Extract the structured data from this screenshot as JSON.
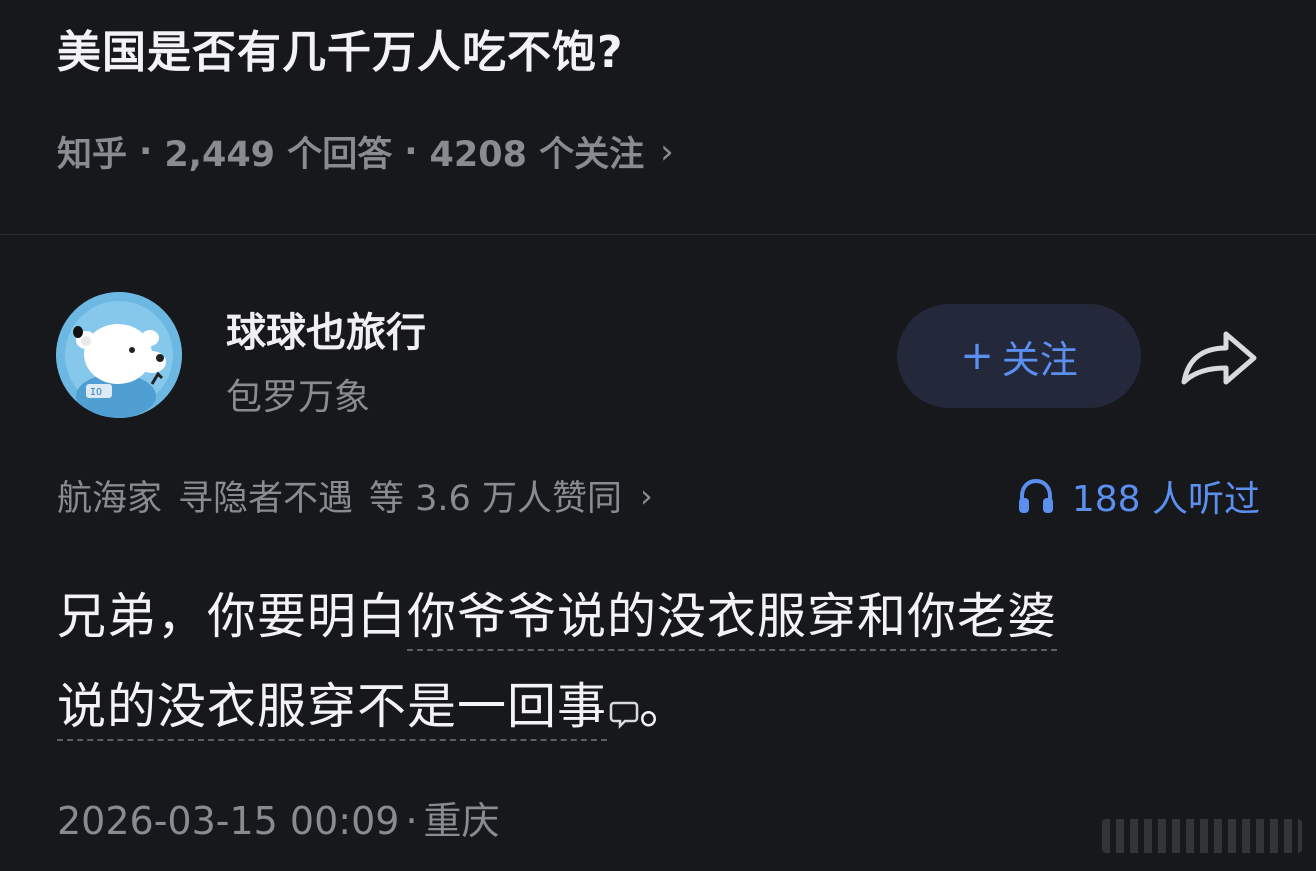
{
  "question": {
    "title": "美国是否有几千万人吃不饱?",
    "source": "知乎",
    "separator": "·",
    "answers": "2,449 个回答",
    "followers": "4208 个关注",
    "chevron": "›"
  },
  "author": {
    "avatar_icon": "polar-bear-avatar-icon",
    "name": "球球也旅行",
    "bio": "包罗万象",
    "follow_plus": "+",
    "follow_label": "关注",
    "share_icon": "share-arrow-icon"
  },
  "votes": {
    "voter1": "航海家",
    "voter2": "寻隐者不遇",
    "summary": "等 3.6 万人赞同",
    "chevron": "›"
  },
  "listen": {
    "icon": "headphones-icon",
    "label": "188 人听过",
    "color": "#5b8ff0"
  },
  "answer": {
    "plain_start": "兄弟，你要明白",
    "highlight_line1": "你爷爷说的没衣服穿和你老婆",
    "highlight_line2": "说的没衣服穿不是一回事",
    "comment_icon": "comment-bubble-icon",
    "end_punct": "。"
  },
  "footer": {
    "datetime": "2026-03-15 00:09",
    "dot": "·",
    "location": "重庆"
  },
  "colors": {
    "background": "#17181c",
    "accent": "#5b8ff0",
    "muted_text": "#8a8b90",
    "follow_bg": "#23283a"
  }
}
